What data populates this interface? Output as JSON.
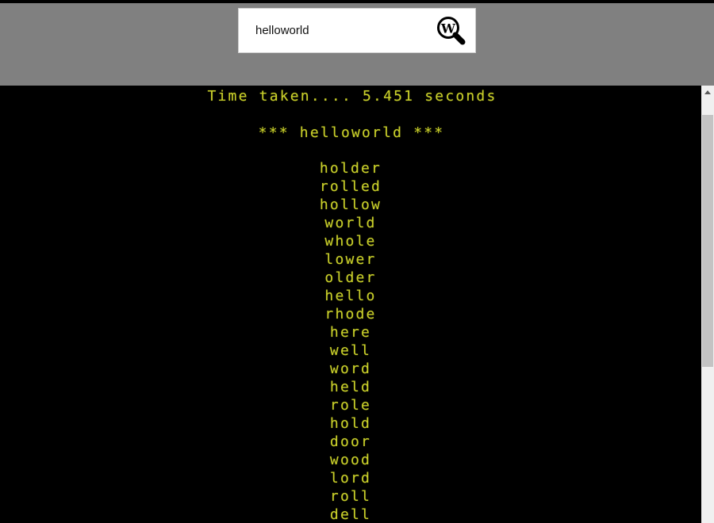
{
  "search": {
    "value": "helloworld",
    "placeholder": "",
    "button_icon": "magnifier-w-icon",
    "button_label": ""
  },
  "terminal": {
    "timing_line": "Time taken.... 5.451 seconds",
    "title_line": "*** helloworld ***",
    "text_color": "#c9cf2b",
    "background_color": "#000000",
    "words": [
      "holder",
      "rolled",
      "hollow",
      "world",
      "whole",
      "lower",
      "older",
      "hello",
      "rhode",
      "here",
      "well",
      "word",
      "held",
      "role",
      "hold",
      "door",
      "wood",
      "lord",
      "roll",
      "dell"
    ]
  },
  "scrollbar": {
    "up_arrow_label": "scroll up",
    "thumb_label": "scroll thumb"
  },
  "chrome": {
    "background_color": "#808080"
  }
}
